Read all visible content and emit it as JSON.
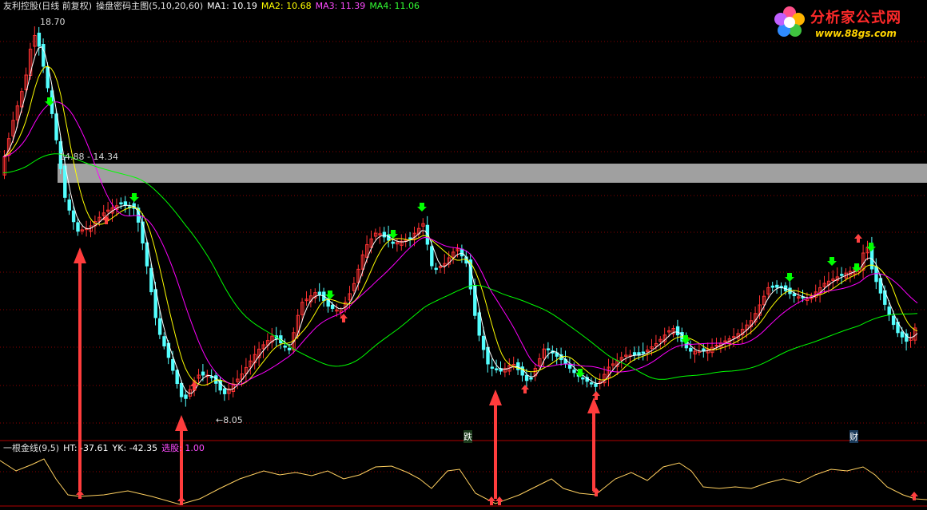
{
  "header": {
    "title": "友利控股(日线 前复权)",
    "formula": "操盘密码主图(5,10,20,60)",
    "ma1": "MA1: 10.19",
    "ma2": "MA2: 10.68",
    "ma3": "MA3: 11.39",
    "ma4": "MA4: 11.06"
  },
  "annotations": {
    "high": "18.70",
    "band": "14.88 - 14.34",
    "low": "←8.05",
    "tag_die": "跌",
    "tag_cai": "财"
  },
  "indicator": {
    "name": "一根金线(9,5)",
    "ht": "HT: -37.61",
    "yk": "YK: -42.35",
    "xuan": "选股: 1.00"
  },
  "logo": {
    "title": "分析家公式网",
    "url": "www.88gs.com"
  },
  "colors": {
    "up": "#ff3232",
    "down": "#54ffff",
    "ma1": "#ffffff",
    "ma2": "#ffff00",
    "ma3": "#ff00ff",
    "ma4": "#00ff00",
    "arrow": "#ff3c3c",
    "band": "#a0a0a0",
    "grid": "#8b0000",
    "indicator_line": "#ffd060"
  }
}
